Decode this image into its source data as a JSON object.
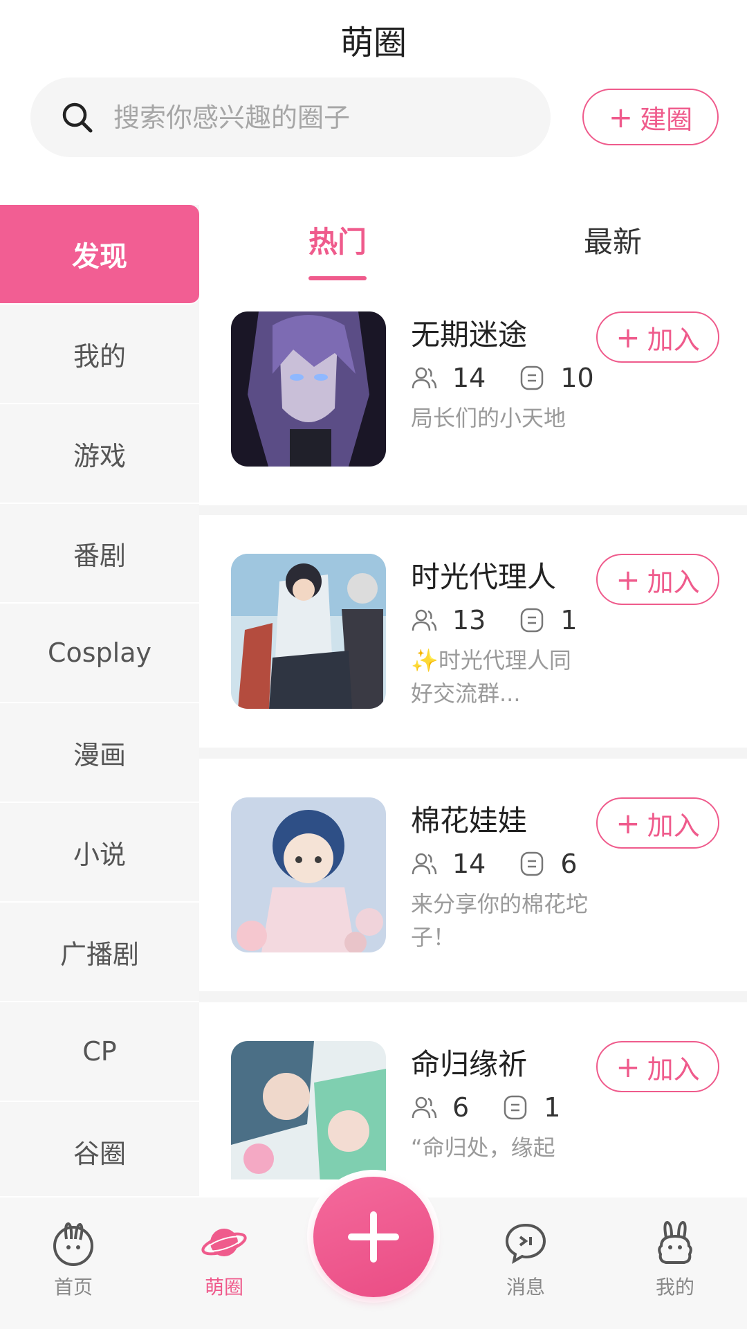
{
  "app": {
    "title": "萌圈"
  },
  "search": {
    "placeholder": "搜索你感兴趣的圈子"
  },
  "header": {
    "create_plus": "+",
    "create_label": "建圈"
  },
  "sidebar": {
    "items": [
      {
        "label": "发现",
        "active": true
      },
      {
        "label": "我的"
      },
      {
        "label": "游戏"
      },
      {
        "label": "番剧"
      },
      {
        "label": "Cosplay"
      },
      {
        "label": "漫画"
      },
      {
        "label": "小说"
      },
      {
        "label": "广播剧"
      },
      {
        "label": "CP"
      },
      {
        "label": "谷圈"
      }
    ]
  },
  "tabs": [
    {
      "label": "热门",
      "active": true
    },
    {
      "label": "最新"
    }
  ],
  "circles": [
    {
      "name": "无期迷途",
      "members": "14",
      "posts": "10",
      "desc": "局长们的小天地",
      "join_plus": "+",
      "join_label": "加入"
    },
    {
      "name": "时光代理人",
      "members": "13",
      "posts": "1",
      "desc": "✨时光代理人同好交流群...",
      "join_plus": "+",
      "join_label": "加入"
    },
    {
      "name": "棉花娃娃",
      "members": "14",
      "posts": "6",
      "desc": "来分享你的棉花坨子！",
      "join_plus": "+",
      "join_label": "加入"
    },
    {
      "name": "命归缘祈",
      "members": "6",
      "posts": "1",
      "desc": "“命归处，缘起",
      "join_plus": "+",
      "join_label": "加入"
    }
  ],
  "bottom_nav": [
    {
      "label": "首页",
      "icon": "rabbit-home-icon"
    },
    {
      "label": "萌圈",
      "icon": "planet-icon",
      "active": true
    },
    {
      "label": "",
      "icon": "plus-icon"
    },
    {
      "label": "消息",
      "icon": "chat-bubble-icon"
    },
    {
      "label": "我的",
      "icon": "rabbit-profile-icon"
    }
  ],
  "colors": {
    "accent": "#ef5b8c",
    "sidebar_bg": "#f6f6f6",
    "muted_text": "#9a9a9a"
  }
}
